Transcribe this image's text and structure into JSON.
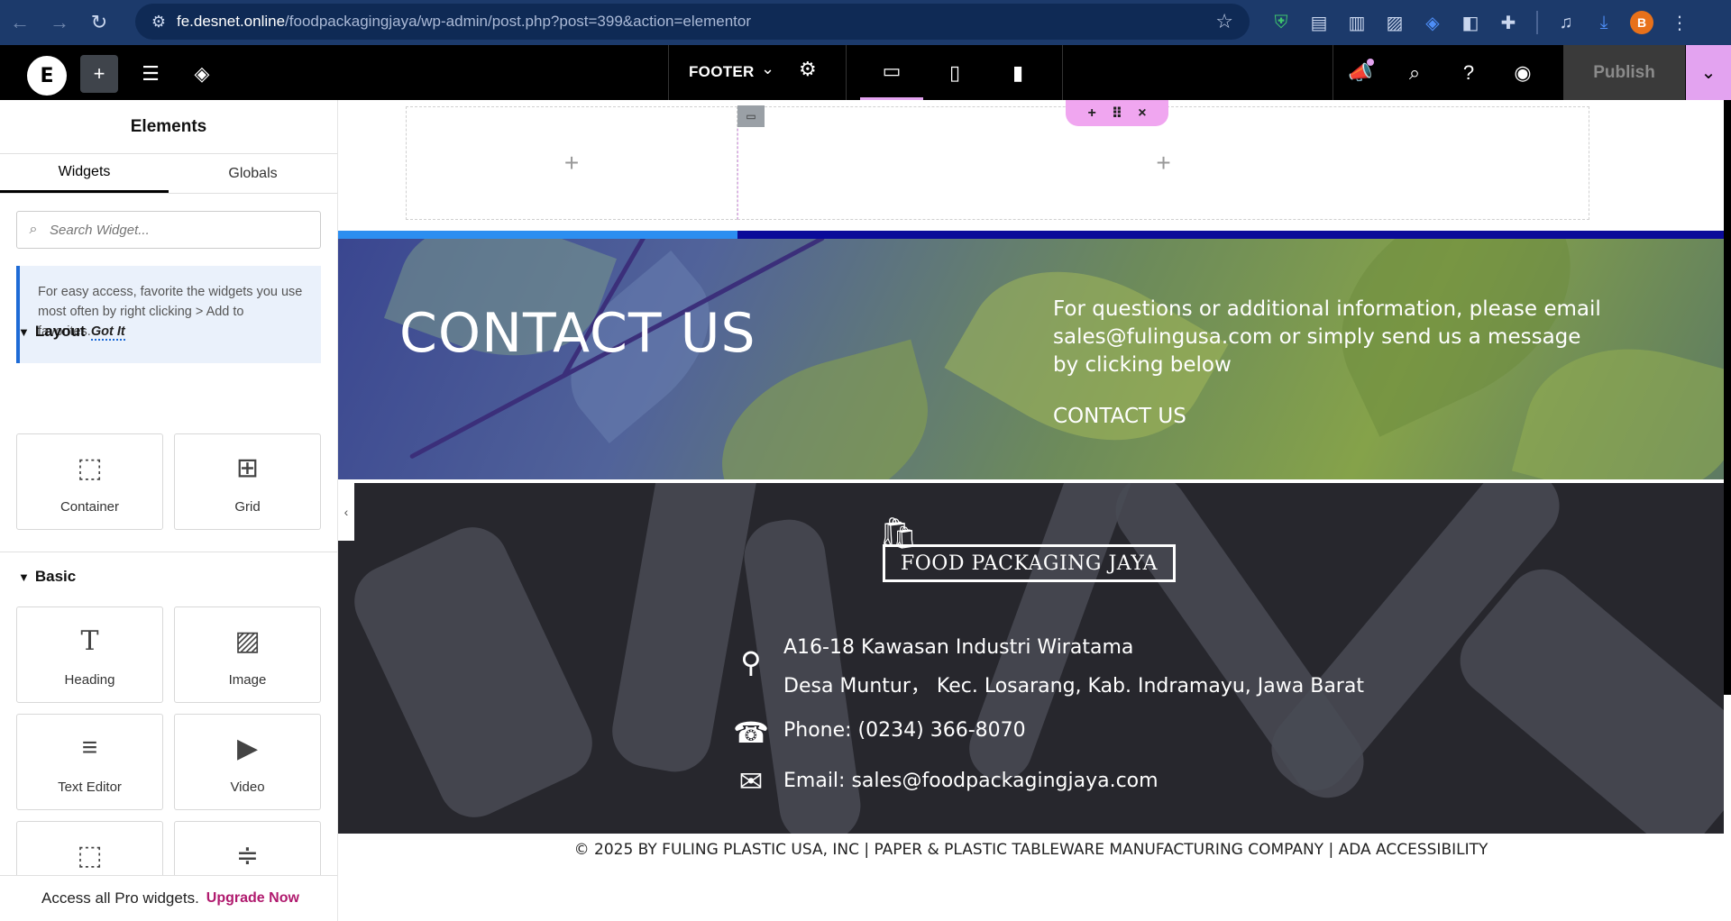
{
  "browser": {
    "url_host": "fe.desnet.online",
    "url_path": "/foodpackagingjaya/wp-admin/post.php?post=399&action=elementor",
    "profile_initial": "B"
  },
  "topbar": {
    "document_title": "FOOTER",
    "publish_label": "Publish"
  },
  "panel": {
    "title": "Elements",
    "tabs": [
      "Widgets",
      "Globals"
    ],
    "search_placeholder": "Search Widget...",
    "tip_text": "For easy access, favorite the widgets you use most often by right clicking > Add to favorites.",
    "tip_link": "Got It",
    "layout_heading": "Layout",
    "layout_widgets": [
      "Container",
      "Grid"
    ],
    "basic_heading": "Basic",
    "basic_widgets": [
      "Heading",
      "Image",
      "Text Editor",
      "Video"
    ],
    "pro_text": "Access all Pro widgets.",
    "pro_link": "Upgrade Now"
  },
  "canvas": {
    "contact_title": "CONTACT US",
    "contact_text": "For questions or additional information, please email sales@fulingusa.com or simply send us a message by clicking below",
    "contact_link": "CONTACT US",
    "logo_text": "FOOD PACKAGING JAYA",
    "address_line1": "A16-18 Kawasan Industri Wiratama",
    "address_line2": "Desa Muntur， Kec. Losarang, Kab. Indramayu, Jawa Barat",
    "phone": "Phone: (0234) 366-8070",
    "email": "Email: sales@foodpackagingjaya.com",
    "copyright": "© 2025 BY FULING PLASTIC USA, INC | PAPER & PLASTIC TABLEWARE MANUFACTURING COMPANY | ADA ACCESSIBILITY"
  },
  "colors": {
    "browser_bar": "#1c3a6b",
    "elementor_accent": "#e3a3f0",
    "tip_accent": "#1e6bd6",
    "upgrade_link": "#b01a6e"
  }
}
